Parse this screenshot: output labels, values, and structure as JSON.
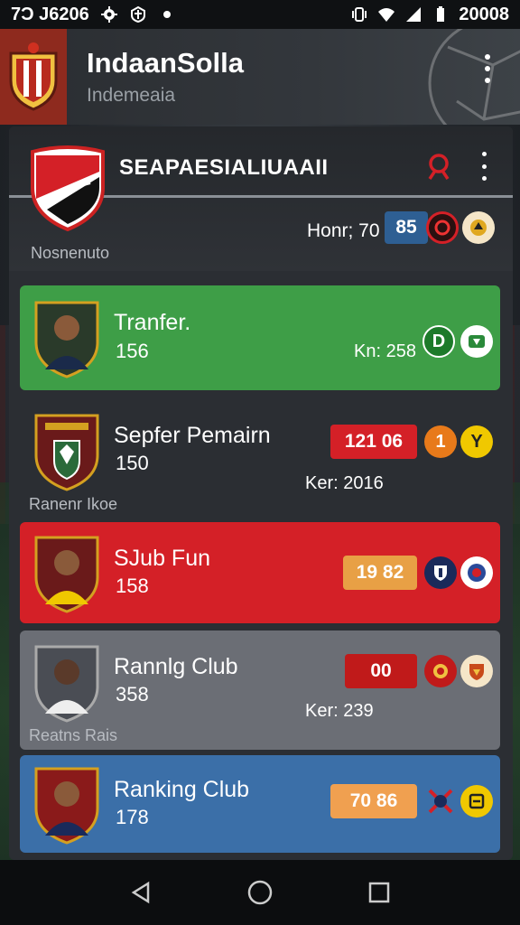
{
  "status_bar": {
    "time": "7Ɔ J6206",
    "battery_text": "20008",
    "icons": [
      "gear-icon",
      "shield-icon",
      "dot-icon",
      "vibrate-icon",
      "wifi-icon",
      "signal-icon",
      "battery-icon"
    ]
  },
  "header": {
    "title": "IndaanSolla",
    "subtitle": "Indemeaia"
  },
  "top_card": {
    "title": "SEAPAESIALIUAAII",
    "caption": "Nosnenuto",
    "stat": "Honr; 70",
    "score": "85"
  },
  "rows": [
    {
      "title": "Tranfer.",
      "number": "156",
      "ker": "Kn: 258",
      "badge": "D",
      "caption": "",
      "score": ""
    },
    {
      "title": "Sepfer Pemairn",
      "number": "150",
      "ker": "Ker: 2016",
      "caption": "Ranenr Ikoe",
      "score": "121  06",
      "badge": "1",
      "badge2": "Y"
    },
    {
      "title": "SJub Fun",
      "number": "158",
      "score": "19 82",
      "ker": "",
      "caption": ""
    },
    {
      "title": "Rannlg Club",
      "number": "358",
      "ker": "Ker: 239",
      "caption": "Reatns Rais",
      "score": "00"
    },
    {
      "title": "Ranking Club",
      "number": "178",
      "score": "70  86",
      "ker": "",
      "caption": ""
    }
  ],
  "colors": {
    "green": "#3e9e47",
    "red": "#d42027",
    "grey": "#6b6e75",
    "blue": "#3b6fa8",
    "orange": "#e8a045"
  }
}
